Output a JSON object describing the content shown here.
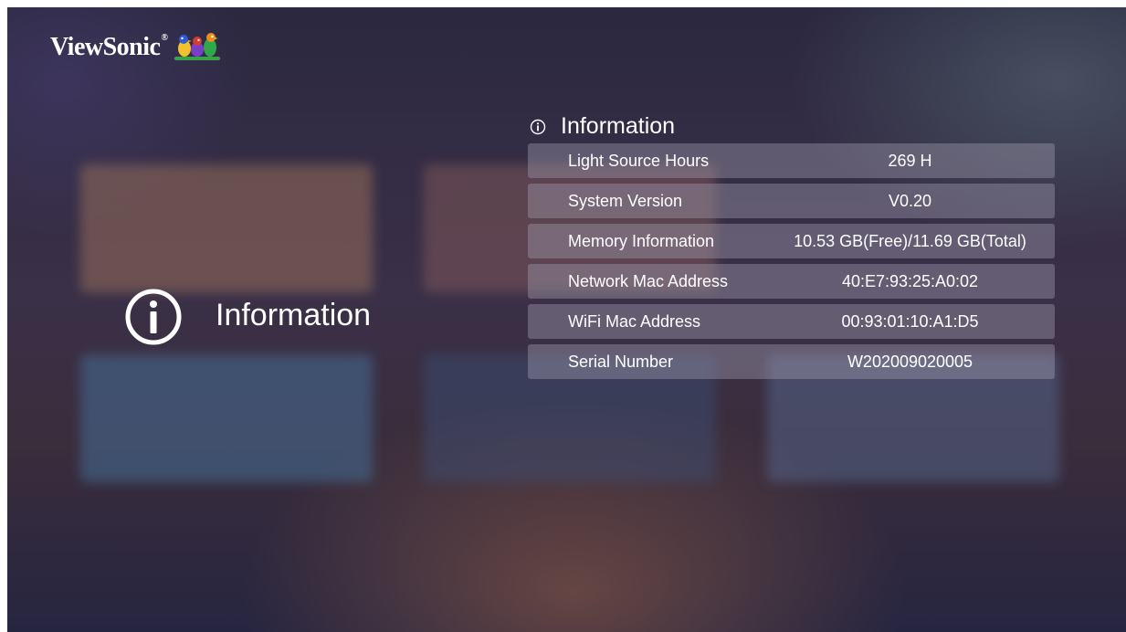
{
  "brand": {
    "name": "ViewSonic",
    "registered": "®",
    "logo_icon": "birds-logo-icon"
  },
  "side": {
    "icon": "info-circle-icon",
    "label": "Information"
  },
  "panel": {
    "icon": "info-circle-icon",
    "title": "Information",
    "rows": [
      {
        "label": "Light Source Hours",
        "value": "269 H"
      },
      {
        "label": "System Version",
        "value": "V0.20"
      },
      {
        "label": "Memory Information",
        "value": "10.53 GB(Free)/11.69 GB(Total)"
      },
      {
        "label": "Network Mac Address",
        "value": "40:E7:93:25:A0:02"
      },
      {
        "label": "WiFi Mac Address",
        "value": "00:93:01:10:A1:D5"
      },
      {
        "label": "Serial Number",
        "value": "W202009020005"
      }
    ]
  }
}
